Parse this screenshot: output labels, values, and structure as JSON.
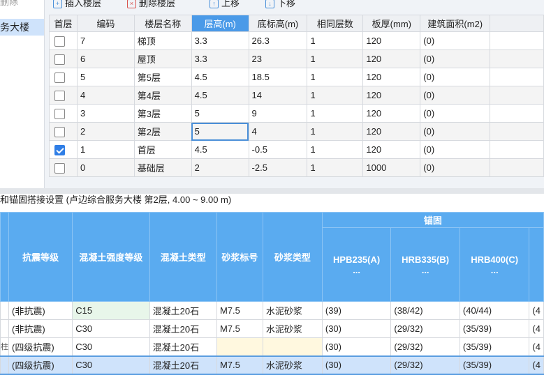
{
  "left_panel": {
    "delete_label": "删除",
    "project_label": "务大楼"
  },
  "toolbar": {
    "insert_label": "插入楼层",
    "delete_label": "删除楼层",
    "up_label": "上移",
    "down_label": "下移"
  },
  "floor_table": {
    "headers": [
      "首层",
      "编码",
      "楼层名称",
      "层高(m)",
      "底标高(m)",
      "相同层数",
      "板厚(mm)",
      "建筑面积(m2)"
    ],
    "rows": [
      {
        "first": false,
        "code": "7",
        "name": "梯顶",
        "height": "3.3",
        "bottom": "26.3",
        "same": "1",
        "thick": "120",
        "area": "(0)"
      },
      {
        "first": false,
        "code": "6",
        "name": "屋顶",
        "height": "3.3",
        "bottom": "23",
        "same": "1",
        "thick": "120",
        "area": "(0)"
      },
      {
        "first": false,
        "code": "5",
        "name": "第5层",
        "height": "4.5",
        "bottom": "18.5",
        "same": "1",
        "thick": "120",
        "area": "(0)"
      },
      {
        "first": false,
        "code": "4",
        "name": "第4层",
        "height": "4.5",
        "bottom": "14",
        "same": "1",
        "thick": "120",
        "area": "(0)"
      },
      {
        "first": false,
        "code": "3",
        "name": "第3层",
        "height": "5",
        "bottom": "9",
        "same": "1",
        "thick": "120",
        "area": "(0)"
      },
      {
        "first": false,
        "code": "2",
        "name": "第2层",
        "height": "5",
        "bottom": "4",
        "same": "1",
        "thick": "120",
        "area": "(0)"
      },
      {
        "first": true,
        "code": "1",
        "name": "首层",
        "height": "4.5",
        "bottom": "-0.5",
        "same": "1",
        "thick": "120",
        "area": "(0)"
      },
      {
        "first": false,
        "code": "0",
        "name": "基础层",
        "height": "2",
        "bottom": "-2.5",
        "same": "1",
        "thick": "1000",
        "area": "(0)"
      }
    ]
  },
  "status_text": "和锚固搭接设置 (卢边综合服务大楼  第2层, 4.00 ~ 9.00 m)",
  "anchor_table": {
    "group_header": "锚固",
    "headers": [
      "抗震等级",
      "混凝土强度等级",
      "混凝土类型",
      "砂浆标号",
      "砂浆类型"
    ],
    "rebar_headers": [
      {
        "name": "HPB235(A)",
        "more": "..."
      },
      {
        "name": "HRB335(B)",
        "more": "..."
      },
      {
        "name": "HRB400(C)",
        "more": "..."
      }
    ],
    "rows": [
      {
        "edge": "",
        "grade": "(非抗震)",
        "strength": "C15",
        "ctype": "混凝土20石",
        "mortar": "M7.5",
        "mtype": "水泥砂浆",
        "a": "(39)",
        "b": "(38/42)",
        "c": "(40/44)",
        "d": "(4"
      },
      {
        "edge": "",
        "grade": "(非抗震)",
        "strength": "C30",
        "ctype": "混凝土20石",
        "mortar": "M7.5",
        "mtype": "水泥砂浆",
        "a": "(30)",
        "b": "(29/32)",
        "c": "(35/39)",
        "d": "(4"
      },
      {
        "edge": "柱",
        "grade": "(四级抗震)",
        "strength": "C30",
        "ctype": "混凝土20石",
        "mortar": "",
        "mtype": "",
        "a": "(30)",
        "b": "(29/32)",
        "c": "(35/39)",
        "d": "(4"
      },
      {
        "edge": "",
        "grade": "(四级抗震)",
        "strength": "C30",
        "ctype": "混凝土20石",
        "mortar": "M7.5",
        "mtype": "水泥砂浆",
        "a": "(30)",
        "b": "(29/32)",
        "c": "(35/39)",
        "d": "(4"
      }
    ]
  }
}
